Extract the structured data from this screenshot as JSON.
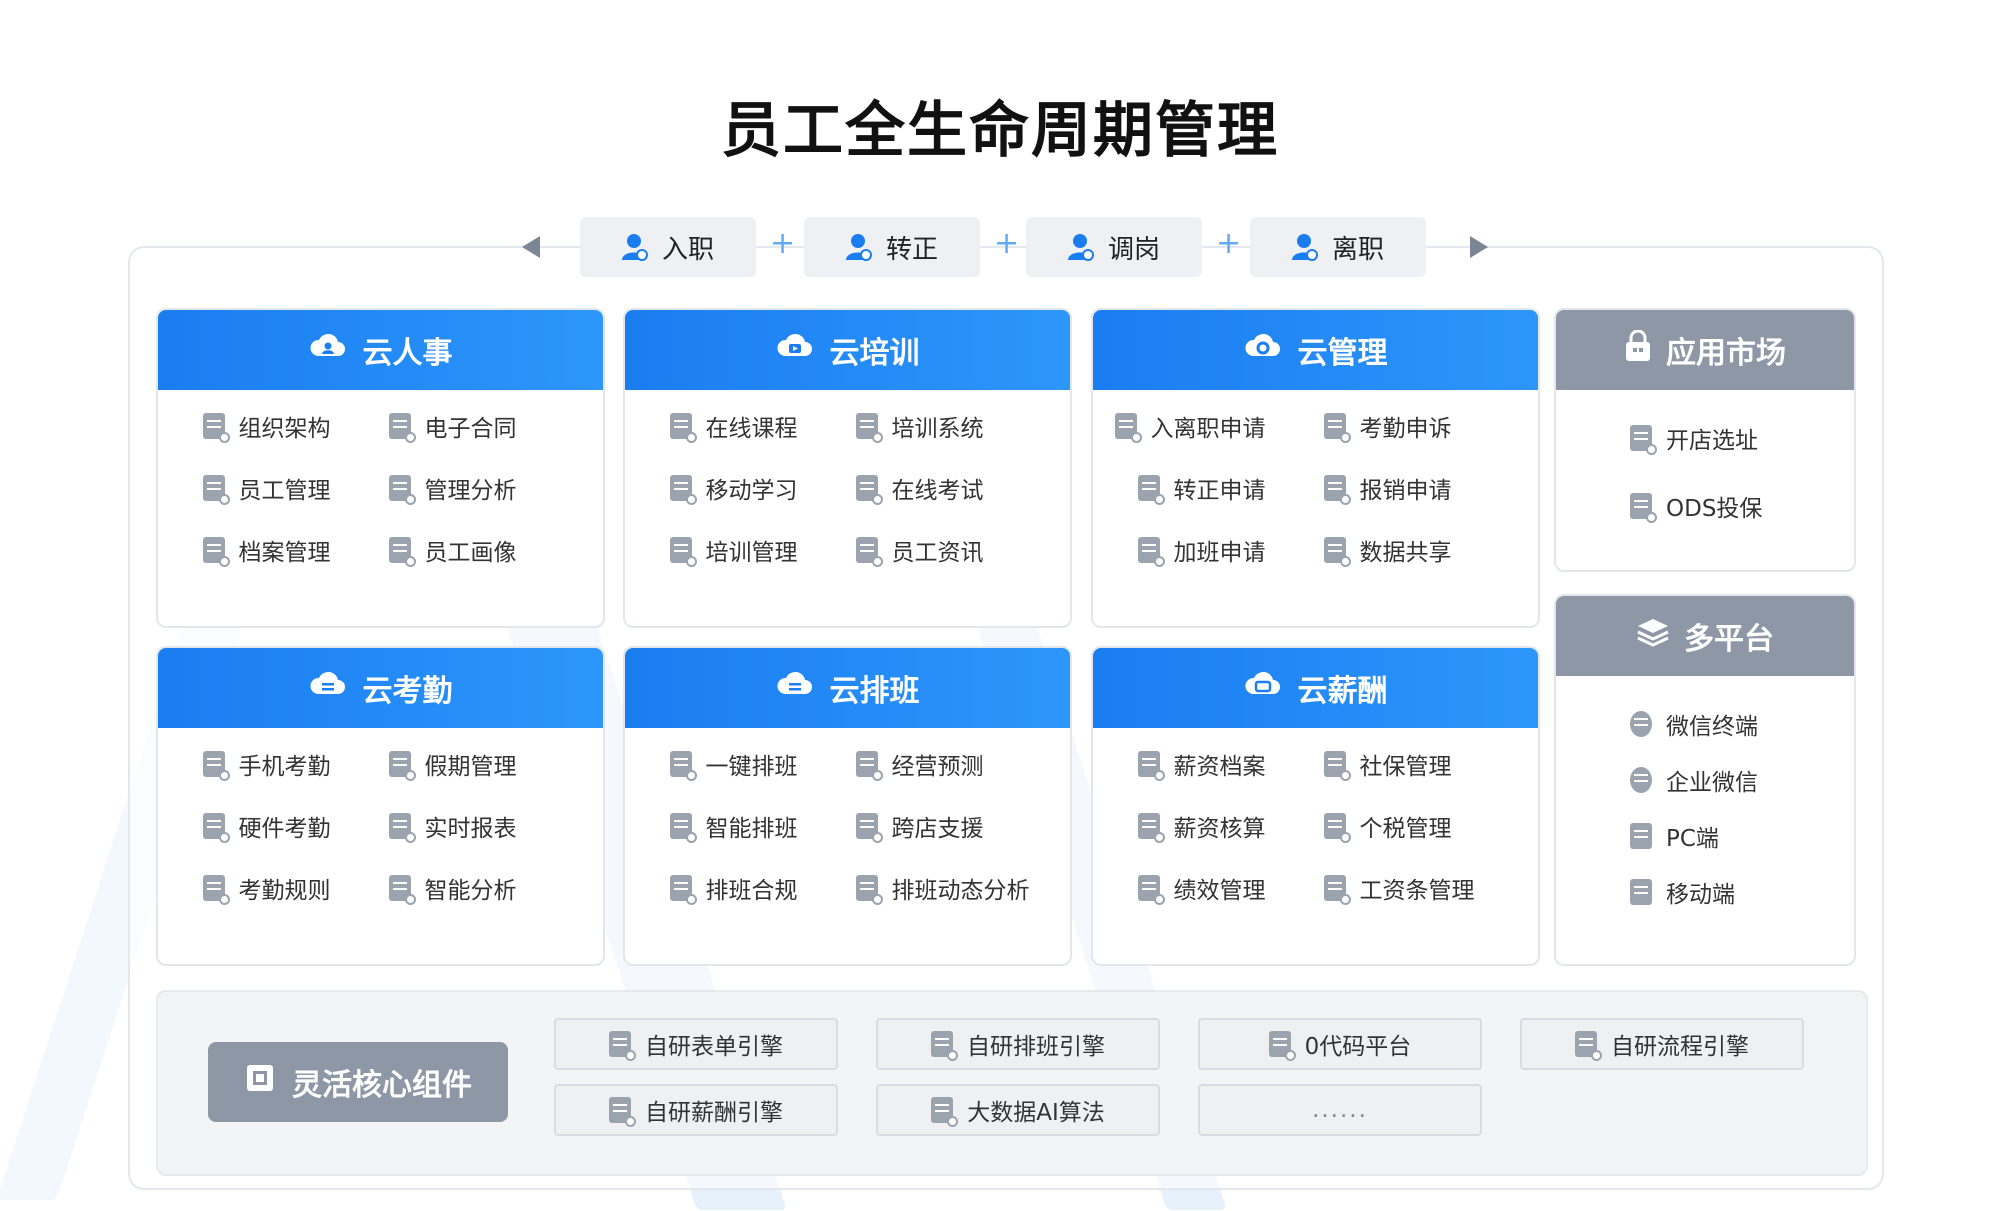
{
  "title": "员工全生命周期管理",
  "lifecycle": {
    "stages": [
      {
        "label": "入职",
        "icon": "user-icon"
      },
      {
        "label": "转正",
        "icon": "user-icon"
      },
      {
        "label": "调岗",
        "icon": "user-icon"
      },
      {
        "label": "离职",
        "icon": "user-icon"
      }
    ],
    "separator": "+"
  },
  "modules": [
    {
      "title": "云人事",
      "icon": "cloud-user-icon",
      "items": [
        "组织架构",
        "电子合同",
        "员工管理",
        "管理分析",
        "档案管理",
        "员工画像"
      ]
    },
    {
      "title": "云培训",
      "icon": "cloud-video-icon",
      "items": [
        "在线课程",
        "培训系统",
        "移动学习",
        "在线考试",
        "培训管理",
        "员工资讯"
      ]
    },
    {
      "title": "云管理",
      "icon": "cloud-gear-icon",
      "items": [
        "入离职申请",
        "考勤申诉",
        "转正申请",
        "报销申请",
        "加班申请",
        "数据共享"
      ]
    },
    {
      "title": "云考勤",
      "icon": "cloud-list-icon",
      "items": [
        "手机考勤",
        "假期管理",
        "硬件考勤",
        "实时报表",
        "考勤规则",
        "智能分析"
      ]
    },
    {
      "title": "云排班",
      "icon": "cloud-list-icon",
      "items": [
        "一键排班",
        "经营预测",
        "智能排班",
        "跨店支援",
        "排班合规",
        "排班动态分析"
      ]
    },
    {
      "title": "云薪酬",
      "icon": "cloud-card-icon",
      "items": [
        "薪资档案",
        "社保管理",
        "薪资核算",
        "个税管理",
        "绩效管理",
        "工资条管理"
      ]
    }
  ],
  "app_market": {
    "title": "应用市场",
    "icon": "lock-icon",
    "items": [
      "开店选址",
      "ODS投保"
    ]
  },
  "platforms": {
    "title": "多平台",
    "icon": "layers-icon",
    "items": [
      "微信终端",
      "企业微信",
      "PC端",
      "移动端"
    ]
  },
  "core": {
    "label": "灵活核心组件",
    "icon": "chip-icon",
    "items": [
      "自研表单引擎",
      "自研排班引擎",
      "0代码平台",
      "自研流程引擎",
      "自研薪酬引擎",
      "大数据AI算法",
      "......"
    ]
  },
  "colors": {
    "primary_blue": "#1a7df0",
    "gray_header": "#8d97a6",
    "title_text": "#111111"
  }
}
